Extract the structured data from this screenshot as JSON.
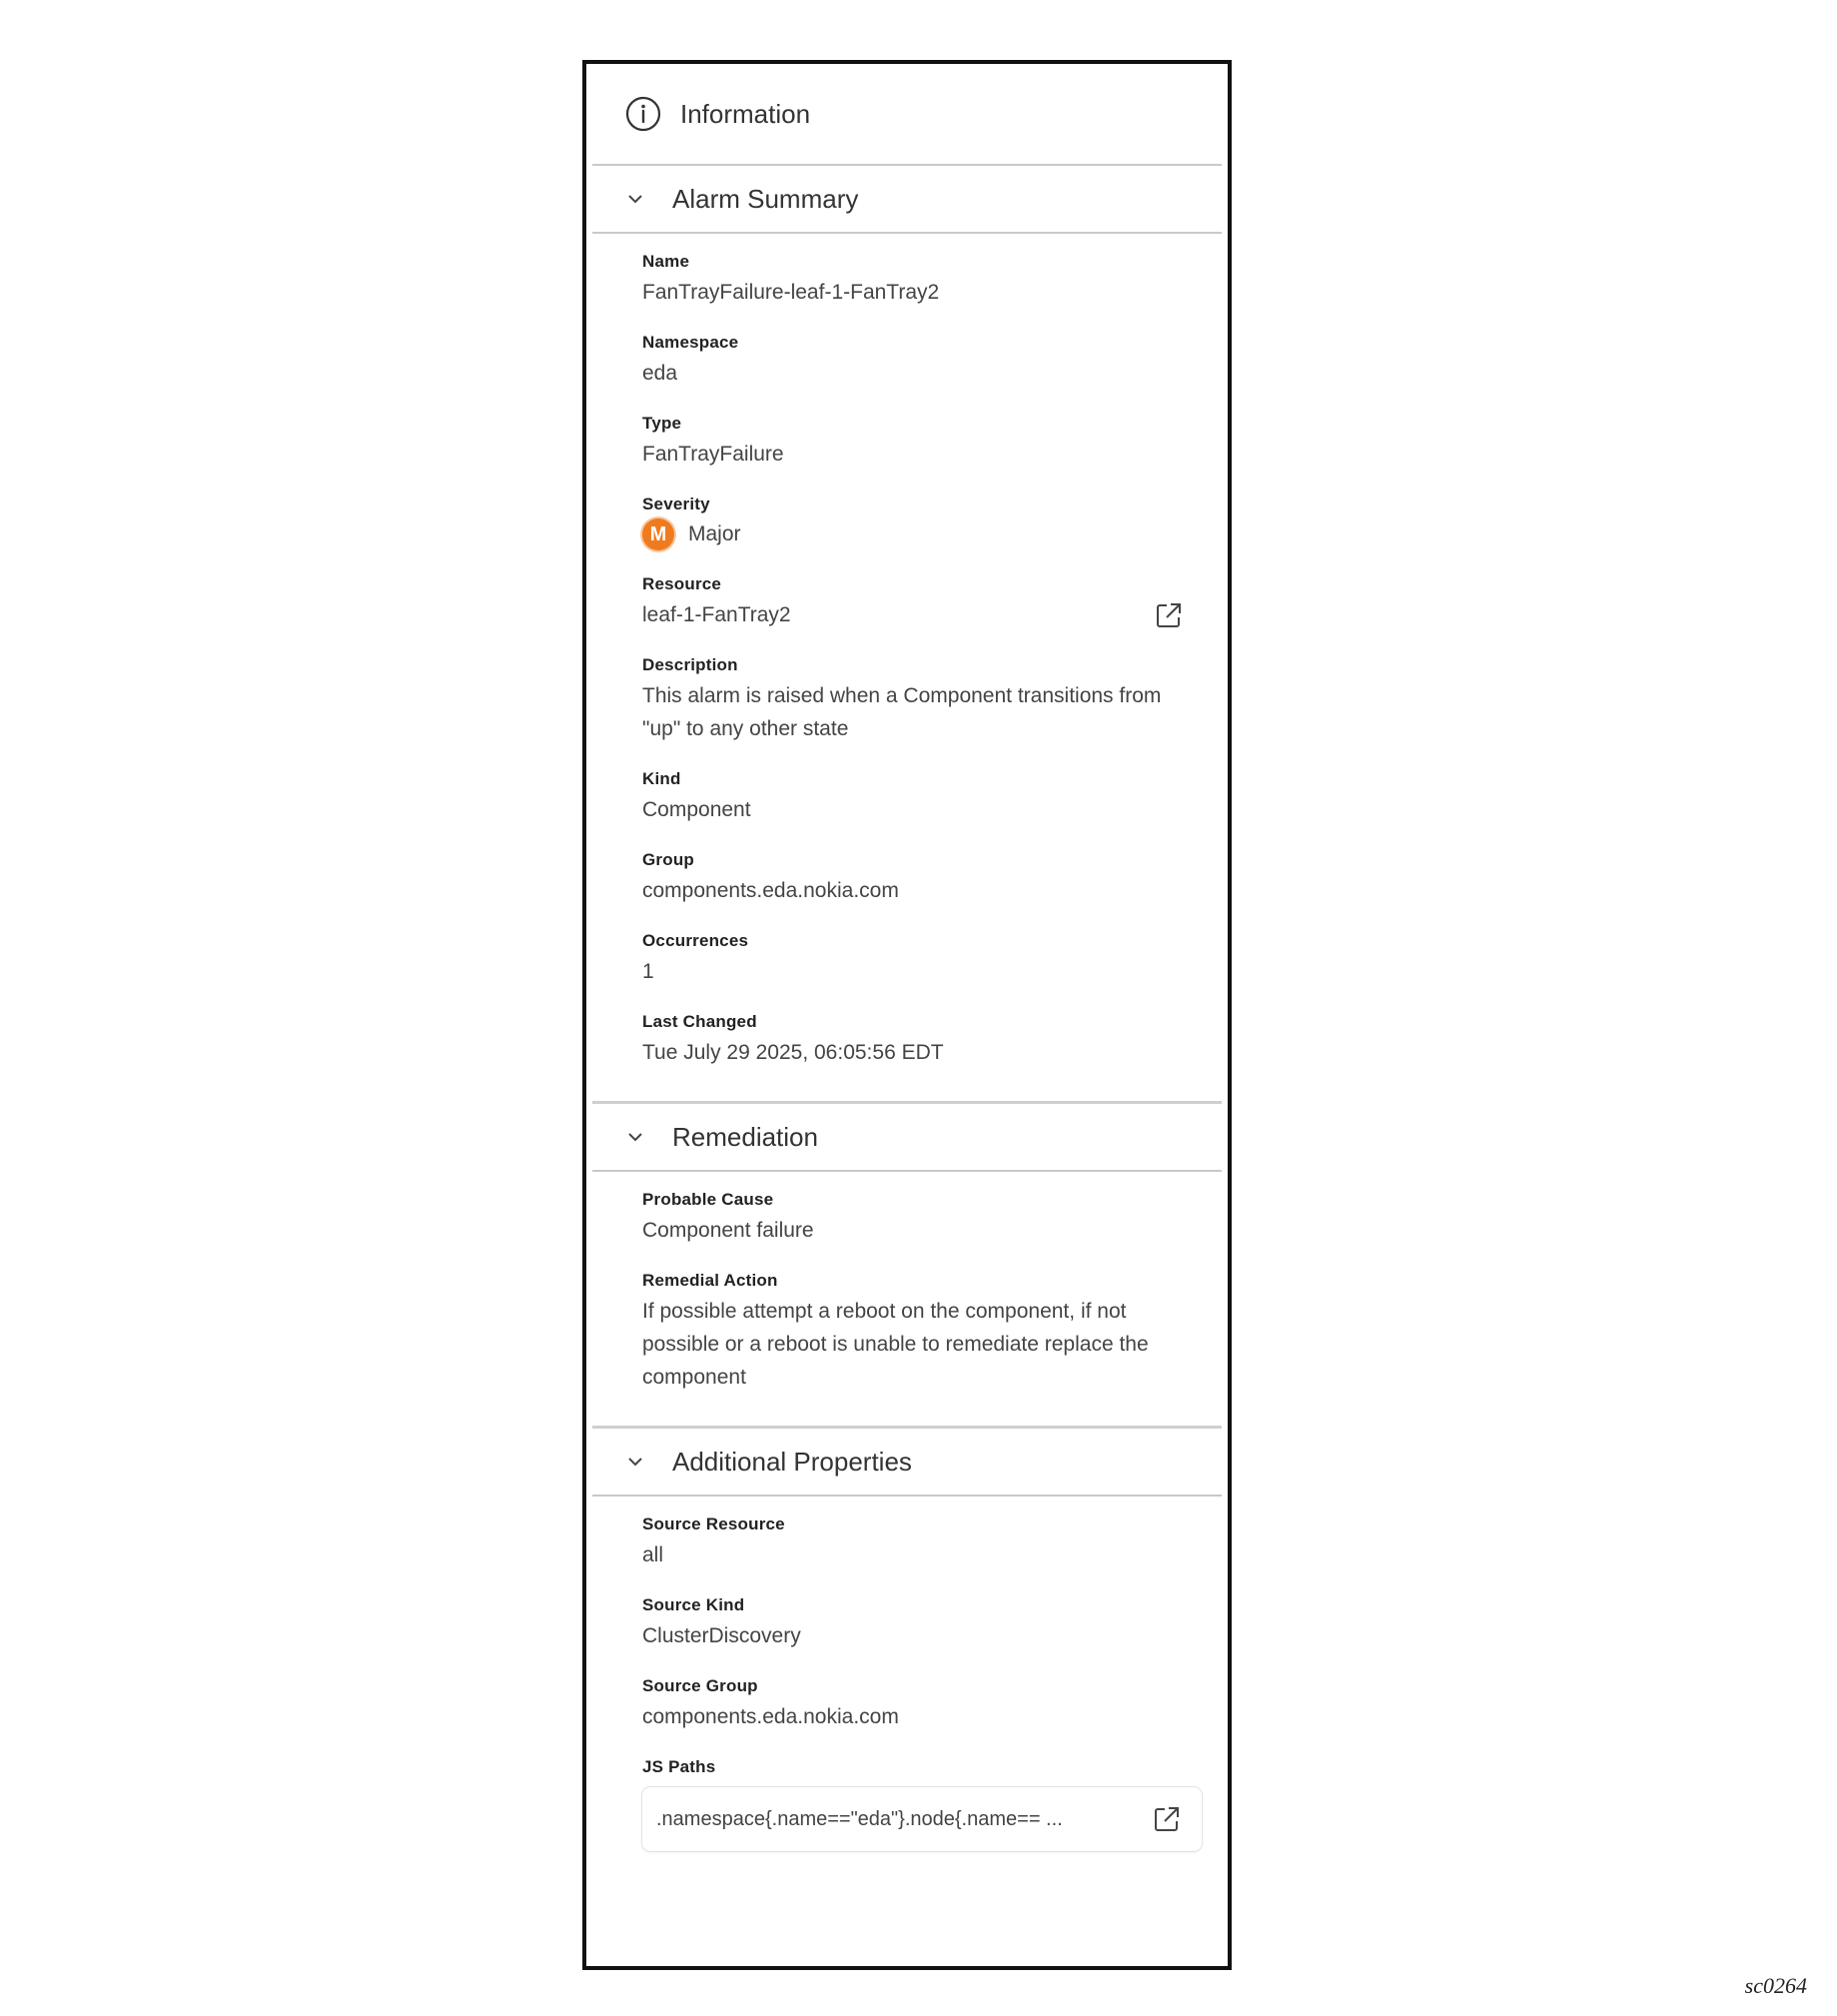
{
  "panel": {
    "title": "Information",
    "icon": "info-circle-icon"
  },
  "alarm_summary": {
    "title": "Alarm Summary",
    "fields": {
      "name": {
        "label": "Name",
        "value": "FanTrayFailure-leaf-1-FanTray2"
      },
      "namespace": {
        "label": "Namespace",
        "value": "eda"
      },
      "type": {
        "label": "Type",
        "value": "FanTrayFailure"
      },
      "severity": {
        "label": "Severity",
        "badge": "M",
        "value": "Major",
        "color": "#f07b1e"
      },
      "resource": {
        "label": "Resource",
        "value": "leaf-1-FanTray2"
      },
      "description": {
        "label": "Description",
        "value": "This alarm is raised when a Component transitions from \"up\" to any other state"
      },
      "kind": {
        "label": "Kind",
        "value": "Component"
      },
      "group": {
        "label": "Group",
        "value": "components.eda.nokia.com"
      },
      "occurrences": {
        "label": "Occurrences",
        "value": "1"
      },
      "last_changed": {
        "label": "Last Changed",
        "value": "Tue July 29 2025, 06:05:56 EDT"
      }
    }
  },
  "remediation": {
    "title": "Remediation",
    "fields": {
      "probable_cause": {
        "label": "Probable Cause",
        "value": "Component failure"
      },
      "remedial_action": {
        "label": "Remedial Action",
        "value": "If possible attempt a reboot on the component, if not possible or a reboot is unable to remediate replace the component"
      }
    }
  },
  "additional_properties": {
    "title": "Additional Properties",
    "fields": {
      "source_resource": {
        "label": "Source Resource",
        "value": "all"
      },
      "source_kind": {
        "label": "Source Kind",
        "value": "ClusterDiscovery"
      },
      "source_group": {
        "label": "Source Group",
        "value": "components.eda.nokia.com"
      },
      "js_paths": {
        "label": "JS Paths",
        "value": ".namespace{.name==\"eda\"}.node{.name== ..."
      }
    }
  },
  "footer": {
    "tag": "sc0264"
  }
}
